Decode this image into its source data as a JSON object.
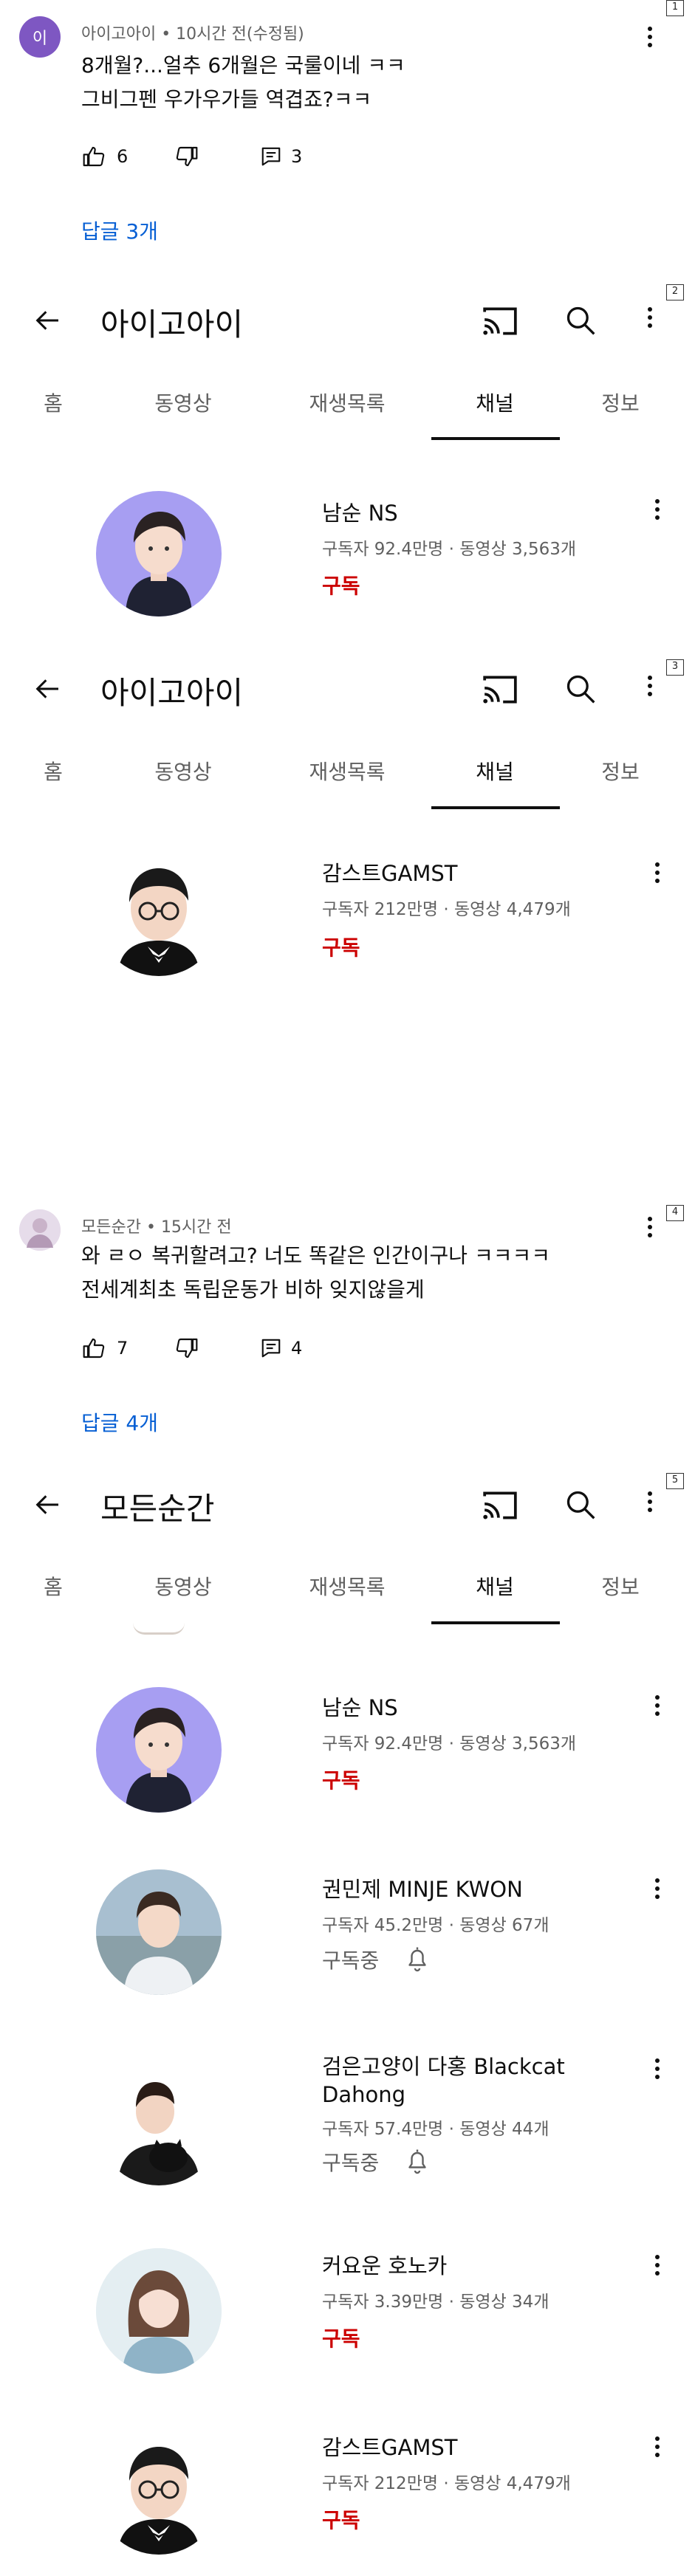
{
  "panel_numbers": [
    "1",
    "2",
    "3",
    "4",
    "5"
  ],
  "comment1": {
    "avatar_letter": "이",
    "author": "아이고아이",
    "time": "10시간 전(수정됨)",
    "text_lines": [
      "8개월?...얼추 6개월은 국룰이네 ㅋㅋ",
      "그비그펜 우가우가들 역겹죠?ㅋㅋ"
    ],
    "likes": "6",
    "replies_count": "3",
    "replies_label": "답글 3개"
  },
  "panel2": {
    "title": "아이고아이",
    "tabs": [
      "홈",
      "동영상",
      "재생목록",
      "채널",
      "정보"
    ],
    "active_tab": "채널",
    "channels": [
      {
        "name": "남순 NS",
        "stats": "구독자 92.4만명 · 동영상 3,563개",
        "status": "구독"
      }
    ]
  },
  "panel3": {
    "title": "아이고아이",
    "tabs": [
      "홈",
      "동영상",
      "재생목록",
      "채널",
      "정보"
    ],
    "active_tab": "채널",
    "channels": [
      {
        "name": "감스트GAMST",
        "stats": "구독자 212만명 · 동영상 4,479개",
        "status": "구독"
      }
    ]
  },
  "comment2": {
    "author": "모든순간",
    "time": "15시간 전",
    "text_lines": [
      "와 ㄹㅇ 복귀할려고? 너도 똑같은 인간이구나 ㅋㅋㅋㅋ",
      "전세계최초 독립운동가 비하 잊지않을게"
    ],
    "likes": "7",
    "replies_count": "4",
    "replies_label": "답글 4개"
  },
  "panel5": {
    "title": "모든순간",
    "tabs": [
      "홈",
      "동영상",
      "재생목록",
      "채널",
      "정보"
    ],
    "active_tab": "채널",
    "channels": [
      {
        "name": "남순 NS",
        "stats": "구독자 92.4만명 · 동영상 3,563개",
        "status": "구독"
      },
      {
        "name": "권민제 MINJE KWON",
        "stats": "구독자 45.2만명 · 동영상 67개",
        "status": "구독중"
      },
      {
        "name": "검은고양이 다홍 Blackcat Dahong",
        "name_lines": [
          "검은고양이 다홍 Blackcat",
          "Dahong"
        ],
        "stats": "구독자 57.4만명 · 동영상 44개",
        "status": "구독중"
      },
      {
        "name": "커요운 호노카",
        "stats": "구독자 3.39만명 · 동영상 34개",
        "status": "구독"
      },
      {
        "name": "감스트GAMST",
        "stats": "구독자 212만명 · 동영상 4,479개",
        "status": "구독"
      }
    ]
  },
  "colors": {
    "subscribe": "#cc0000",
    "reply_link": "#065fd4",
    "meta": "#606060",
    "comment_avatar": "#7e57c2"
  }
}
